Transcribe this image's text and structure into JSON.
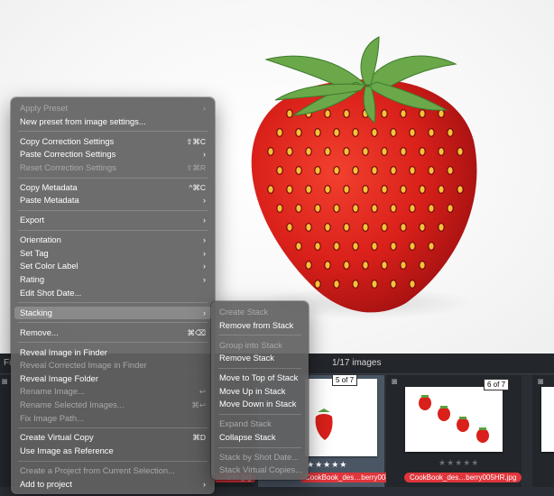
{
  "filmstrip": {
    "count_label": "1/17 images",
    "left_label": "Fi",
    "thumbs": [
      {
        "badge": "5 of 7",
        "rating": "★★★★★",
        "filename": "CookBook_des…berry004HR.jpg"
      },
      {
        "badge": "6 of 7",
        "rating": "★★★★★",
        "filename": "CookBook_des…berry005HR.jpg"
      }
    ],
    "left_filename": "…sHR.jpg"
  },
  "context_menu": {
    "items": [
      {
        "label": "Apply Preset",
        "disabled": true,
        "shortcut": "",
        "submenu": true
      },
      {
        "label": "New preset from image settings...",
        "disabled": false,
        "shortcut": "",
        "submenu": false
      },
      {
        "sep": true
      },
      {
        "label": "Copy Correction Settings",
        "disabled": false,
        "shortcut": "⇧⌘C",
        "submenu": false
      },
      {
        "label": "Paste Correction Settings",
        "disabled": false,
        "shortcut": "",
        "submenu": true
      },
      {
        "label": "Reset Correction Settings",
        "disabled": true,
        "shortcut": "⇧⌘R",
        "submenu": false
      },
      {
        "sep": true
      },
      {
        "label": "Copy Metadata",
        "disabled": false,
        "shortcut": "^⌘C",
        "submenu": false
      },
      {
        "label": "Paste Metadata",
        "disabled": false,
        "shortcut": "",
        "submenu": true
      },
      {
        "sep": true
      },
      {
        "label": "Export",
        "disabled": false,
        "shortcut": "",
        "submenu": true
      },
      {
        "sep": true
      },
      {
        "label": "Orientation",
        "disabled": false,
        "shortcut": "",
        "submenu": true
      },
      {
        "label": "Set Tag",
        "disabled": false,
        "shortcut": "",
        "submenu": true
      },
      {
        "label": "Set Color Label",
        "disabled": false,
        "shortcut": "",
        "submenu": true
      },
      {
        "label": "Rating",
        "disabled": false,
        "shortcut": "",
        "submenu": true
      },
      {
        "label": "Edit Shot Date...",
        "disabled": false,
        "shortcut": "",
        "submenu": false
      },
      {
        "sep": true
      },
      {
        "label": "Stacking",
        "disabled": false,
        "shortcut": "",
        "submenu": true,
        "highlighted": true
      },
      {
        "sep": true
      },
      {
        "label": "Remove...",
        "disabled": false,
        "shortcut": "⌘⌫",
        "submenu": false
      },
      {
        "sep": true
      },
      {
        "label": "Reveal Image in Finder",
        "disabled": false,
        "shortcut": "",
        "submenu": false
      },
      {
        "label": "Reveal Corrected Image in Finder",
        "disabled": true,
        "shortcut": "",
        "submenu": false
      },
      {
        "label": "Reveal Image Folder",
        "disabled": false,
        "shortcut": "",
        "submenu": false
      },
      {
        "label": "Rename Image...",
        "disabled": true,
        "shortcut": "↩",
        "submenu": false
      },
      {
        "label": "Rename Selected Images...",
        "disabled": true,
        "shortcut": "⌘↩",
        "submenu": false
      },
      {
        "label": "Fix Image Path...",
        "disabled": true,
        "shortcut": "",
        "submenu": false
      },
      {
        "sep": true
      },
      {
        "label": "Create Virtual Copy",
        "disabled": false,
        "shortcut": "⌘D",
        "submenu": false
      },
      {
        "label": "Use Image as Reference",
        "disabled": false,
        "shortcut": "",
        "submenu": false
      },
      {
        "sep": true
      },
      {
        "label": "Create a Project from Current Selection...",
        "disabled": true,
        "shortcut": "",
        "submenu": false
      },
      {
        "label": "Add to project",
        "disabled": false,
        "shortcut": "",
        "submenu": true
      }
    ]
  },
  "stacking_submenu": {
    "items": [
      {
        "label": "Create Stack",
        "disabled": true
      },
      {
        "label": "Remove from Stack",
        "disabled": false
      },
      {
        "sep": true
      },
      {
        "label": "Group into Stack",
        "disabled": true
      },
      {
        "label": "Remove Stack",
        "disabled": false
      },
      {
        "sep": true
      },
      {
        "label": "Move to Top of Stack",
        "disabled": false
      },
      {
        "label": "Move Up in Stack",
        "disabled": false
      },
      {
        "label": "Move Down in Stack",
        "disabled": false
      },
      {
        "sep": true
      },
      {
        "label": "Expand Stack",
        "disabled": true
      },
      {
        "label": "Collapse Stack",
        "disabled": false
      },
      {
        "sep": true
      },
      {
        "label": "Stack by Shot Date...",
        "disabled": true
      },
      {
        "label": "Stack Virtual Copies...",
        "disabled": true
      }
    ]
  },
  "colors": {
    "menu_bg": "#626262",
    "highlight": "#8a8a8a",
    "filename_label": "#e0353b",
    "filmstrip_bg": "#2b2f35"
  }
}
